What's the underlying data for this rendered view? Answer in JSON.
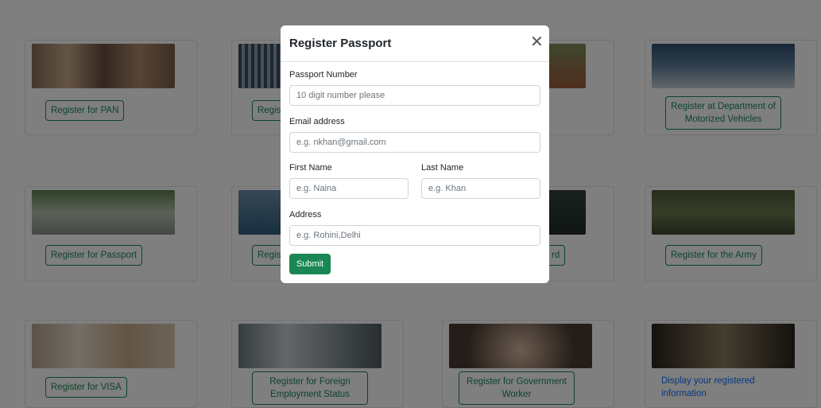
{
  "cards": {
    "pan": "Register for PAN",
    "row1_col2_partial": "Regist",
    "dmv": "Register at Department of Motorized Vehicles",
    "passport": "Register for Passport",
    "row2_col2_partial": "Regist",
    "row2_col3_partial": "rd",
    "army": "Register for the Army",
    "visa": "Register for VISA",
    "foreign_employment": "Register for Foreign Employment Status",
    "govt_worker": "Register for Government Worker",
    "display_info": "Display your registered information"
  },
  "modal": {
    "title": "Register Passport",
    "close_icon": "close-icon",
    "passport_label": "Passport Number",
    "passport_placeholder": "10 digit number please",
    "email_label": "Email address",
    "email_placeholder": "e.g. nkhan@gmail.com",
    "first_name_label": "First Name",
    "first_name_placeholder": "e.g. Naina",
    "last_name_label": "Last Name",
    "last_name_placeholder": "e.g. Khan",
    "address_label": "Address",
    "address_placeholder": "e.g. Rohini,Delhi",
    "submit_label": "Submit"
  },
  "colors": {
    "primary_green": "#198754",
    "link_blue": "#0d6efd",
    "backdrop": "rgba(0,0,0,0.5)"
  }
}
